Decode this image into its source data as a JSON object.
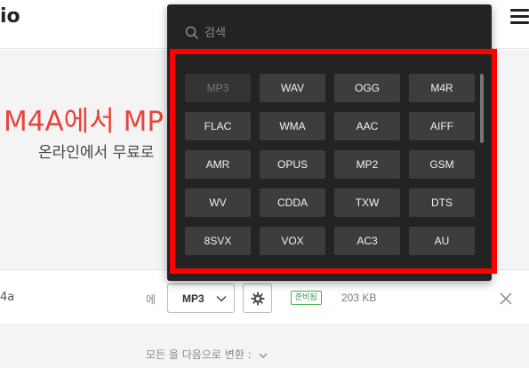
{
  "header": {
    "logo_text": "io"
  },
  "hero": {
    "title": "M4A에서 MP",
    "subtitle": "온라인에서 무료로"
  },
  "file_row": {
    "file_name": "4a",
    "to_label": "에",
    "selected_format": "MP3",
    "status_badge": "준비됨",
    "file_size": "203 KB"
  },
  "bottom": {
    "convert_all_label": "모든 을 다음으로 변환 :"
  },
  "dropdown": {
    "search_placeholder": "검색",
    "formats": [
      "MP3",
      "WAV",
      "OGG",
      "M4R",
      "FLAC",
      "WMA",
      "AAC",
      "AIFF",
      "AMR",
      "OPUS",
      "MP2",
      "GSM",
      "WV",
      "CDDA",
      "TXW",
      "DTS",
      "8SVX",
      "VOX",
      "AC3",
      "AU"
    ],
    "disabled_format": "MP3"
  },
  "colors": {
    "accent_red": "#e8443a",
    "highlight_red": "#ff0000",
    "panel_bg": "#232323",
    "button_bg": "#3d3d3d",
    "badge_green": "#2e9e4a"
  },
  "icons": [
    "menu-icon",
    "search-icon",
    "chevron-down-icon",
    "gear-icon",
    "close-icon"
  ]
}
